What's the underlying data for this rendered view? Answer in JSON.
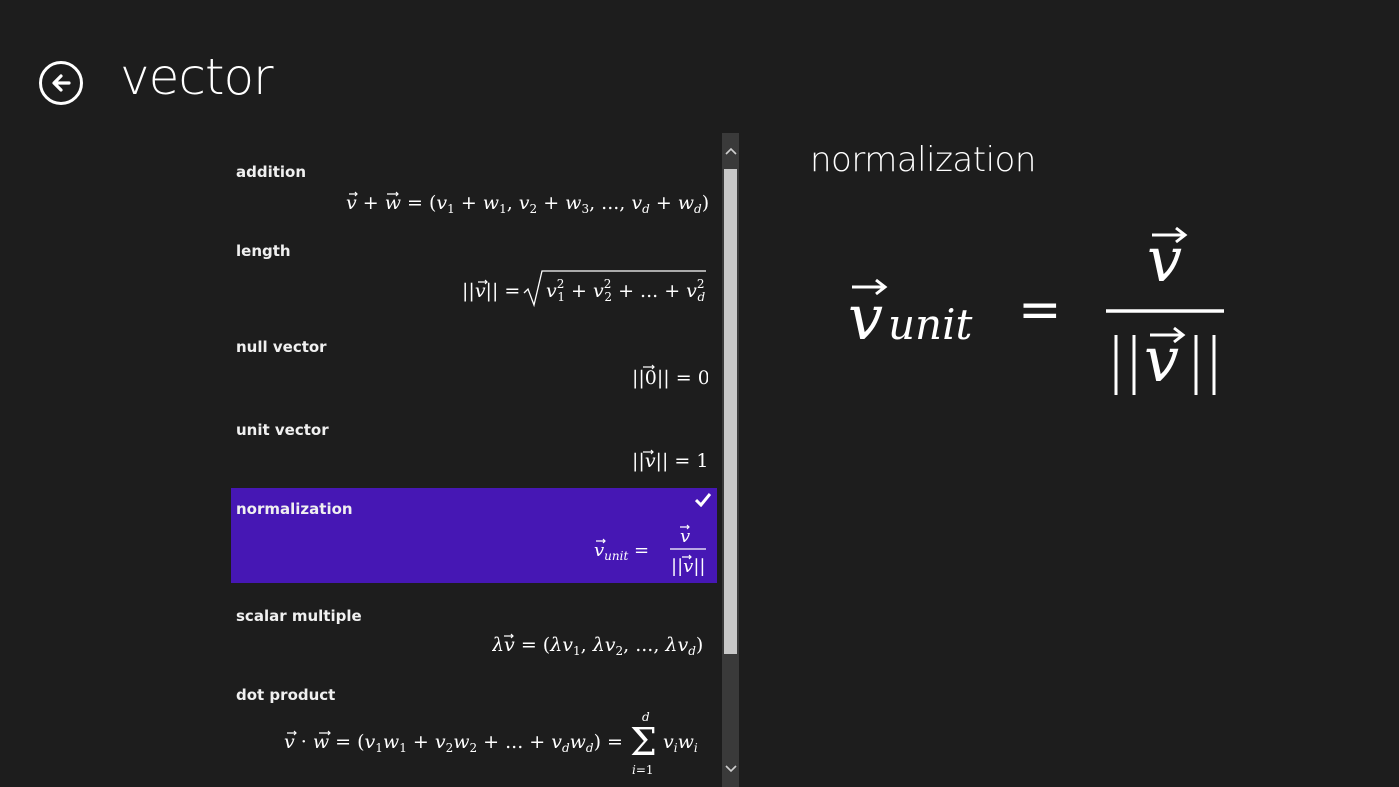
{
  "header": {
    "title": "vector",
    "back_icon": "back-arrow-icon"
  },
  "items": [
    {
      "label": "addition",
      "formula": "v⃗ + w⃗ = (v₁ + w₁, v₂ + w₃, ..., v_d + w_d)"
    },
    {
      "label": "length",
      "formula": "||v⃗|| = √(v₁² + v₂² + ... + v_d²)"
    },
    {
      "label": "null vector",
      "formula": "||0⃗|| = 0"
    },
    {
      "label": "unit vector",
      "formula": "||v⃗|| = 1"
    },
    {
      "label": "normalization",
      "formula": "v⃗_unit = v⃗ / ||v⃗||",
      "selected": true
    },
    {
      "label": "scalar multiple",
      "formula": "λv⃗ = (λv₁, λv₂, ..., λv_d)"
    },
    {
      "label": "dot product",
      "formula": "v⃗ · w⃗ = (v₁w₁ + v₂w₂ + ... + v_dw_d) = Σ_{i=1}^{d} v_iw_i"
    }
  ],
  "detail": {
    "title": "normalization",
    "formula": "v⃗_unit = v⃗ / ||v⃗||"
  },
  "colors": {
    "background": "#1d1d1d",
    "selected": "#4617b4",
    "scroll_track": "#3a3a3a",
    "scroll_thumb": "#c8c8c8"
  }
}
